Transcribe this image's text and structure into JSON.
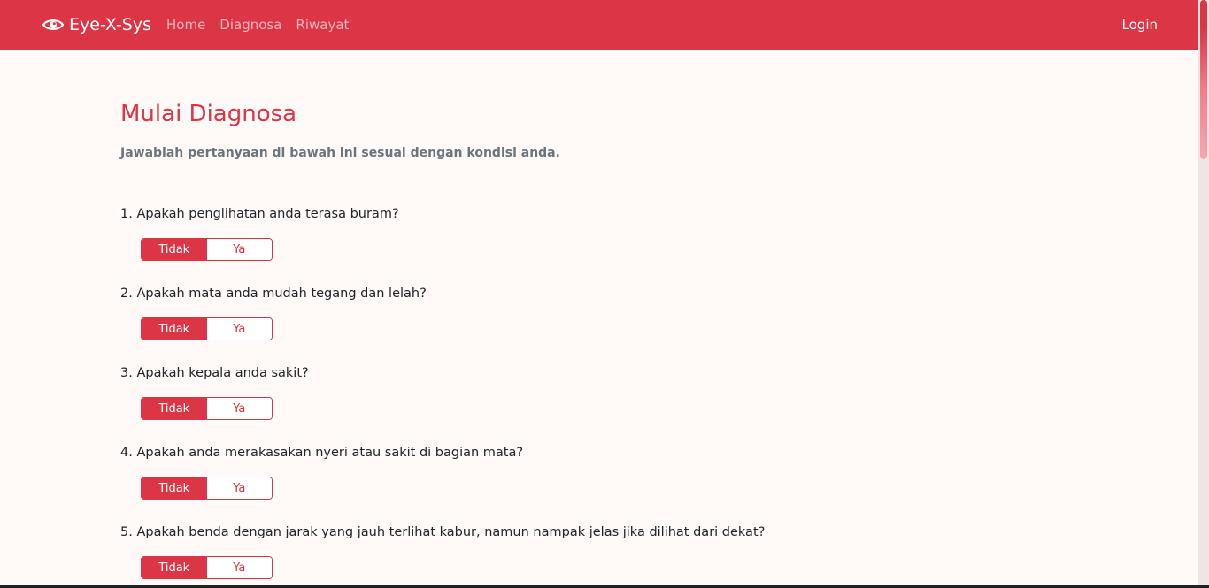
{
  "navbar": {
    "brand": "Eye-X-Sys",
    "brand_icon": "eye-icon",
    "links": [
      "Home",
      "Diagnosa",
      "Riwayat"
    ],
    "login": "Login",
    "accent_color": "#dc3545"
  },
  "main": {
    "title": "Mulai Diagnosa",
    "subtitle": "Jawablah pertanyaan di bawah ini sesuai dengan kondisi anda."
  },
  "questions": [
    {
      "text": "1. Apakah penglihatan anda terasa buram?",
      "option_no": "Tidak",
      "option_yes": "Ya",
      "selected": "Tidak"
    },
    {
      "text": "2. Apakah mata anda mudah tegang dan lelah?",
      "option_no": "Tidak",
      "option_yes": "Ya",
      "selected": "Tidak"
    },
    {
      "text": "3. Apakah kepala anda sakit?",
      "option_no": "Tidak",
      "option_yes": "Ya",
      "selected": "Tidak"
    },
    {
      "text": "4. Apakah anda merakasakan nyeri atau sakit di bagian mata?",
      "option_no": "Tidak",
      "option_yes": "Ya",
      "selected": "Tidak"
    },
    {
      "text": "5. Apakah benda dengan jarak yang jauh terlihat kabur, namun nampak jelas jika dilihat dari dekat?",
      "option_no": "Tidak",
      "option_yes": "Ya",
      "selected": "Tidak"
    }
  ]
}
